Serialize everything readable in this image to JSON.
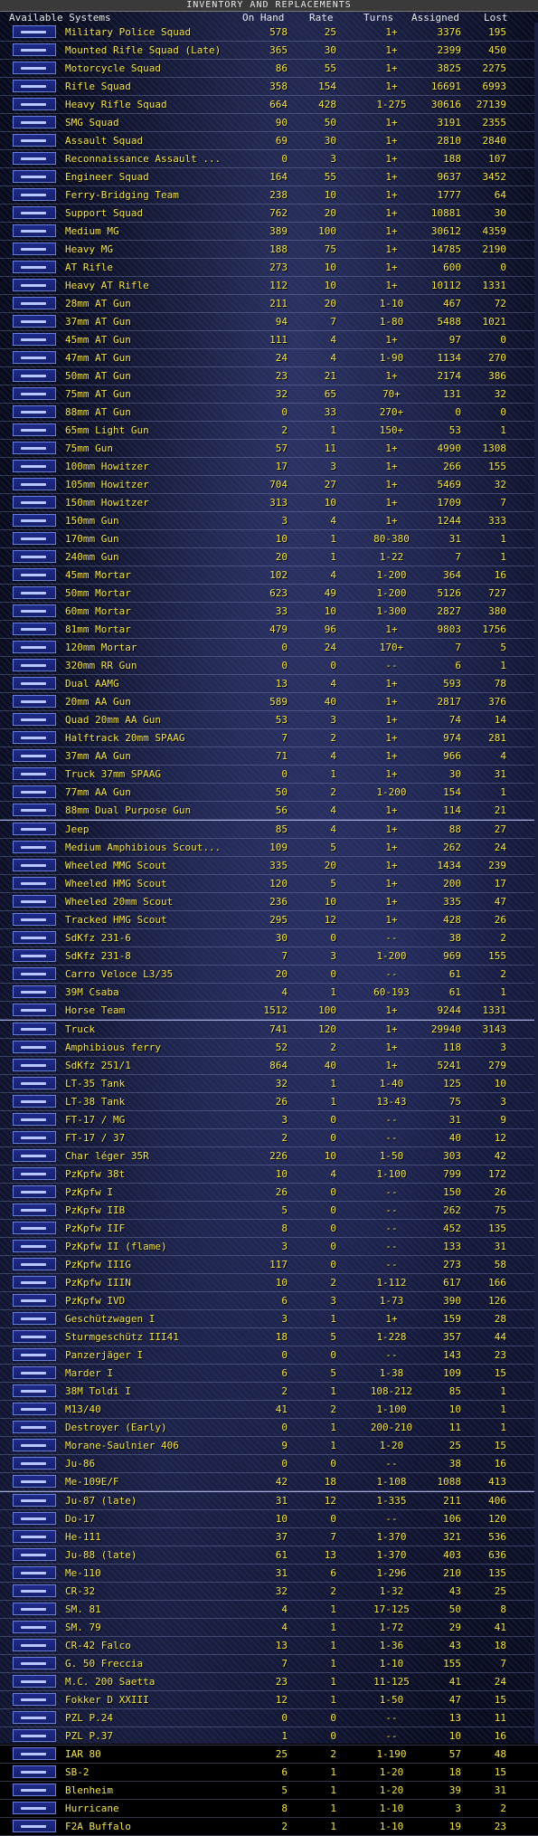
{
  "window": {
    "title": "INVENTORY AND REPLACEMENTS"
  },
  "columns": {
    "name": "Available Systems",
    "onhand": "On Hand",
    "rate": "Rate",
    "turns": "Turns",
    "assigned": "Assigned",
    "lost": "Lost"
  },
  "rows": [
    [
      "Military Police Squad",
      "578",
      "25",
      "1+",
      "3376",
      "195"
    ],
    [
      "Mounted Rifle Squad (Late)",
      "365",
      "30",
      "1+",
      "2399",
      "450"
    ],
    [
      "Motorcycle Squad",
      "86",
      "55",
      "1+",
      "3825",
      "2275"
    ],
    [
      "Rifle Squad",
      "358",
      "154",
      "1+",
      "16691",
      "6993"
    ],
    [
      "Heavy Rifle Squad",
      "664",
      "428",
      "1-275",
      "30616",
      "27139"
    ],
    [
      "SMG Squad",
      "90",
      "50",
      "1+",
      "3191",
      "2355"
    ],
    [
      "Assault Squad",
      "69",
      "30",
      "1+",
      "2810",
      "2840"
    ],
    [
      "Reconnaissance Assault ...",
      "0",
      "3",
      "1+",
      "188",
      "107"
    ],
    [
      "Engineer Squad",
      "164",
      "55",
      "1+",
      "9637",
      "3452"
    ],
    [
      "Ferry-Bridging Team",
      "238",
      "10",
      "1+",
      "1777",
      "64"
    ],
    [
      "Support Squad",
      "762",
      "20",
      "1+",
      "10881",
      "30"
    ],
    [
      "Medium MG",
      "389",
      "100",
      "1+",
      "30612",
      "4359"
    ],
    [
      "Heavy MG",
      "188",
      "75",
      "1+",
      "14785",
      "2190"
    ],
    [
      "AT Rifle",
      "273",
      "10",
      "1+",
      "600",
      "0"
    ],
    [
      "Heavy AT Rifle",
      "112",
      "10",
      "1+",
      "10112",
      "1331"
    ],
    [
      "28mm AT Gun",
      "211",
      "20",
      "1-10",
      "467",
      "72"
    ],
    [
      "37mm AT Gun",
      "94",
      "7",
      "1-80",
      "5488",
      "1021"
    ],
    [
      "45mm AT Gun",
      "111",
      "4",
      "1+",
      "97",
      "0"
    ],
    [
      "47mm AT Gun",
      "24",
      "4",
      "1-90",
      "1134",
      "270"
    ],
    [
      "50mm AT Gun",
      "23",
      "21",
      "1+",
      "2174",
      "386"
    ],
    [
      "75mm AT Gun",
      "32",
      "65",
      "70+",
      "131",
      "32"
    ],
    [
      "88mm AT Gun",
      "0",
      "33",
      "270+",
      "0",
      "0"
    ],
    [
      "65mm Light Gun",
      "2",
      "1",
      "150+",
      "53",
      "1"
    ],
    [
      "75mm Gun",
      "57",
      "11",
      "1+",
      "4990",
      "1308"
    ],
    [
      "100mm Howitzer",
      "17",
      "3",
      "1+",
      "266",
      "155"
    ],
    [
      "105mm Howitzer",
      "704",
      "27",
      "1+",
      "5469",
      "32"
    ],
    [
      "150mm Howitzer",
      "313",
      "10",
      "1+",
      "1709",
      "7"
    ],
    [
      "150mm Gun",
      "3",
      "4",
      "1+",
      "1244",
      "333"
    ],
    [
      "170mm Gun",
      "10",
      "1",
      "80-380",
      "31",
      "1"
    ],
    [
      "240mm Gun",
      "20",
      "1",
      "1-22",
      "7",
      "1"
    ],
    [
      "45mm Mortar",
      "102",
      "4",
      "1-200",
      "364",
      "16"
    ],
    [
      "50mm Mortar",
      "623",
      "49",
      "1-200",
      "5126",
      "727"
    ],
    [
      "60mm Mortar",
      "33",
      "10",
      "1-300",
      "2827",
      "380"
    ],
    [
      "81mm Mortar",
      "479",
      "96",
      "1+",
      "9803",
      "1756"
    ],
    [
      "120mm Mortar",
      "0",
      "24",
      "170+",
      "7",
      "5"
    ],
    [
      "320mm RR Gun",
      "0",
      "0",
      "--",
      "6",
      "1"
    ],
    [
      "Dual AAMG",
      "13",
      "4",
      "1+",
      "593",
      "78"
    ],
    [
      "20mm AA Gun",
      "589",
      "40",
      "1+",
      "2817",
      "376"
    ],
    [
      "Quad 20mm AA Gun",
      "53",
      "3",
      "1+",
      "74",
      "14"
    ],
    [
      "Halftrack 20mm SPAAG",
      "7",
      "2",
      "1+",
      "974",
      "281"
    ],
    [
      "37mm AA Gun",
      "71",
      "4",
      "1+",
      "966",
      "4"
    ],
    [
      "Truck 37mm SPAAG",
      "0",
      "1",
      "1+",
      "30",
      "31"
    ],
    [
      "77mm AA Gun",
      "50",
      "2",
      "1-200",
      "154",
      "1"
    ],
    [
      "88mm Dual Purpose Gun",
      "56",
      "4",
      "1+",
      "114",
      "21"
    ],
    [
      "Jeep",
      "85",
      "4",
      "1+",
      "88",
      "27"
    ],
    [
      "Medium Amphibious Scout...",
      "109",
      "5",
      "1+",
      "262",
      "24"
    ],
    [
      "Wheeled MMG Scout",
      "335",
      "20",
      "1+",
      "1434",
      "239"
    ],
    [
      "Wheeled HMG Scout",
      "120",
      "5",
      "1+",
      "200",
      "17"
    ],
    [
      "Wheeled 20mm Scout",
      "236",
      "10",
      "1+",
      "335",
      "47"
    ],
    [
      "Tracked HMG Scout",
      "295",
      "12",
      "1+",
      "428",
      "26"
    ],
    [
      "SdKfz 231-6",
      "30",
      "0",
      "--",
      "38",
      "2"
    ],
    [
      "SdKfz 231-8",
      "7",
      "3",
      "1-200",
      "969",
      "155"
    ],
    [
      "Carro Veloce L3/35",
      "20",
      "0",
      "--",
      "61",
      "2"
    ],
    [
      "39M Csaba",
      "4",
      "1",
      "60-193",
      "61",
      "1"
    ],
    [
      "Horse Team",
      "1512",
      "100",
      "1+",
      "9244",
      "1331"
    ],
    [
      "Truck",
      "741",
      "120",
      "1+",
      "29940",
      "3143"
    ],
    [
      "Amphibious ferry",
      "52",
      "2",
      "1+",
      "118",
      "3"
    ],
    [
      "SdKfz 251/1",
      "864",
      "40",
      "1+",
      "5241",
      "279"
    ],
    [
      "LT-35 Tank",
      "32",
      "1",
      "1-40",
      "125",
      "10"
    ],
    [
      "LT-38 Tank",
      "26",
      "1",
      "13-43",
      "75",
      "3"
    ],
    [
      "FT-17 / MG",
      "3",
      "0",
      "--",
      "31",
      "9"
    ],
    [
      "FT-17 / 37",
      "2",
      "0",
      "--",
      "40",
      "12"
    ],
    [
      "Char léger 35R",
      "226",
      "10",
      "1-50",
      "303",
      "42"
    ],
    [
      "PzKpfw 38t",
      "10",
      "4",
      "1-100",
      "799",
      "172"
    ],
    [
      "PzKpfw I",
      "26",
      "0",
      "--",
      "150",
      "26"
    ],
    [
      "PzKpfw IIB",
      "5",
      "0",
      "--",
      "262",
      "75"
    ],
    [
      "PzKpfw IIF",
      "8",
      "0",
      "--",
      "452",
      "135"
    ],
    [
      "PzKpfw II (flame)",
      "3",
      "0",
      "--",
      "133",
      "31"
    ],
    [
      "PzKpfw IIIG",
      "117",
      "0",
      "--",
      "273",
      "58"
    ],
    [
      "PzKpfw IIIN",
      "10",
      "2",
      "1-112",
      "617",
      "166"
    ],
    [
      "PzKpfw IVD",
      "6",
      "3",
      "1-73",
      "390",
      "126"
    ],
    [
      "Geschützwagen I",
      "3",
      "1",
      "1+",
      "159",
      "28"
    ],
    [
      "Sturmgeschütz III41",
      "18",
      "5",
      "1-228",
      "357",
      "44"
    ],
    [
      "Panzerjäger I",
      "0",
      "0",
      "--",
      "143",
      "23"
    ],
    [
      "Marder I",
      "6",
      "5",
      "1-38",
      "109",
      "15"
    ],
    [
      "38M Toldi I",
      "2",
      "1",
      "108-212",
      "85",
      "1"
    ],
    [
      "M13/40",
      "41",
      "2",
      "1-100",
      "10",
      "1"
    ],
    [
      "Destroyer (Early)",
      "0",
      "1",
      "200-210",
      "11",
      "1"
    ],
    [
      "Morane-Saulnier 406",
      "9",
      "1",
      "1-20",
      "25",
      "15"
    ],
    [
      "Ju-86",
      "0",
      "0",
      "--",
      "38",
      "16"
    ],
    [
      "Me-109E/F",
      "42",
      "18",
      "1-108",
      "1088",
      "413"
    ],
    [
      "Ju-87 (late)",
      "31",
      "12",
      "1-335",
      "211",
      "406"
    ],
    [
      "Do-17",
      "10",
      "0",
      "--",
      "106",
      "120"
    ],
    [
      "He-111",
      "37",
      "7",
      "1-370",
      "321",
      "536"
    ],
    [
      "Ju-88 (late)",
      "61",
      "13",
      "1-370",
      "403",
      "636"
    ],
    [
      "Me-110",
      "31",
      "6",
      "1-296",
      "210",
      "135"
    ],
    [
      "CR-32",
      "32",
      "2",
      "1-32",
      "43",
      "25"
    ],
    [
      "SM. 81",
      "4",
      "1",
      "17-125",
      "50",
      "8"
    ],
    [
      "SM. 79",
      "4",
      "1",
      "1-72",
      "29",
      "41"
    ],
    [
      "CR-42 Falco",
      "13",
      "1",
      "1-36",
      "43",
      "18"
    ],
    [
      "G. 50 Freccia",
      "7",
      "1",
      "1-10",
      "155",
      "7"
    ],
    [
      "M.C. 200 Saetta",
      "23",
      "1",
      "11-125",
      "41",
      "24"
    ],
    [
      "Fokker D XXIII",
      "12",
      "1",
      "1-50",
      "47",
      "15"
    ],
    [
      "PZL P.24",
      "0",
      "0",
      "--",
      "13",
      "11"
    ],
    [
      "PZL P.37",
      "1",
      "0",
      "--",
      "10",
      "16"
    ],
    [
      "IAR 80",
      "25",
      "2",
      "1-190",
      "57",
      "48"
    ],
    [
      "SB-2",
      "6",
      "1",
      "1-20",
      "18",
      "15"
    ],
    [
      "Blenheim",
      "5",
      "1",
      "1-20",
      "39",
      "31"
    ],
    [
      "Hurricane",
      "8",
      "1",
      "1-10",
      "3",
      "2"
    ],
    [
      "F2A Buffalo",
      "2",
      "1",
      "1-10",
      "19",
      "23"
    ]
  ]
}
